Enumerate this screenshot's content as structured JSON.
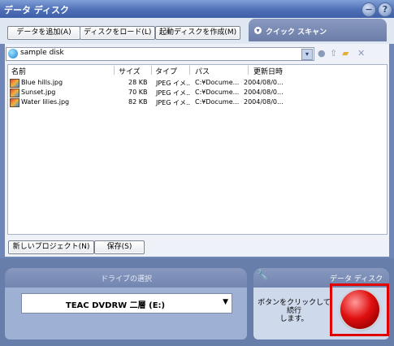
{
  "title": "データ ディスク",
  "toolbar": {
    "add_data": "データを追加(A)",
    "load_disc": "ディスクをロード(L)",
    "make_boot_disc": "起動ディスクを作成(M)",
    "quick_scan": "クイック スキャン"
  },
  "path_bar": {
    "value": "sample disk"
  },
  "columns": [
    "名前",
    "サイズ",
    "タイプ",
    "パス",
    "更新日時"
  ],
  "files": [
    {
      "name": "Blue hills.jpg",
      "size": "28 KB",
      "type": "JPEG イメ..",
      "path": "C:¥Docume...",
      "modified": "2004/08/0..."
    },
    {
      "name": "Sunset.jpg",
      "size": "70 KB",
      "type": "JPEG イメ..",
      "path": "C:¥Docume...",
      "modified": "2004/08/0..."
    },
    {
      "name": "Water lilies.jpg",
      "size": "82 KB",
      "type": "JPEG イメ..",
      "path": "C:¥Docume...",
      "modified": "2004/08/0..."
    }
  ],
  "bottom_buttons": {
    "new_project": "新しいプロジェクト(N)",
    "save": "保存(S)"
  },
  "drive_panel": {
    "title": "ドライブの選択",
    "selected": "TEAC DVDRW 二層 (E:)"
  },
  "action_panel": {
    "title": "データ ディスク",
    "hint_line1": "ボタンをクリックして続行",
    "hint_line2": "します。"
  },
  "icons": {
    "minimize": "minimize-icon",
    "help": "help-icon",
    "quick_scan": "chevron-icon",
    "path": "globe-icon",
    "wrench": "wrench-icon"
  },
  "colors": {
    "accent": "#4f70b6",
    "go_button": "#e01010",
    "highlight": "#e00000"
  }
}
